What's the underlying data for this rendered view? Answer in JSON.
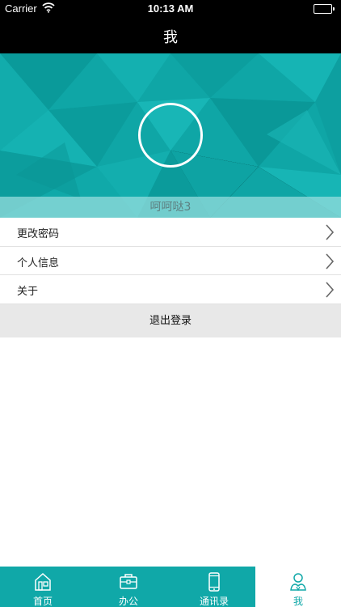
{
  "status_bar": {
    "carrier": "Carrier",
    "time": "10:13 AM",
    "battery_level": 1.0
  },
  "nav": {
    "title": "我"
  },
  "profile": {
    "username": "呵呵哒3"
  },
  "menu": {
    "items": [
      {
        "label": "更改密码"
      },
      {
        "label": "个人信息"
      },
      {
        "label": "关于"
      }
    ],
    "logout_label": "退出登录"
  },
  "tabs": [
    {
      "label": "首页",
      "icon": "home-icon",
      "active": false
    },
    {
      "label": "办公",
      "icon": "briefcase-icon",
      "active": false
    },
    {
      "label": "通讯录",
      "icon": "phone-icon",
      "active": false
    },
    {
      "label": "我",
      "icon": "user-icon",
      "active": true
    }
  ],
  "colors": {
    "accent": "#10a8a8",
    "bar_bg": "#000000",
    "logout_bg": "#e8e8e8"
  }
}
